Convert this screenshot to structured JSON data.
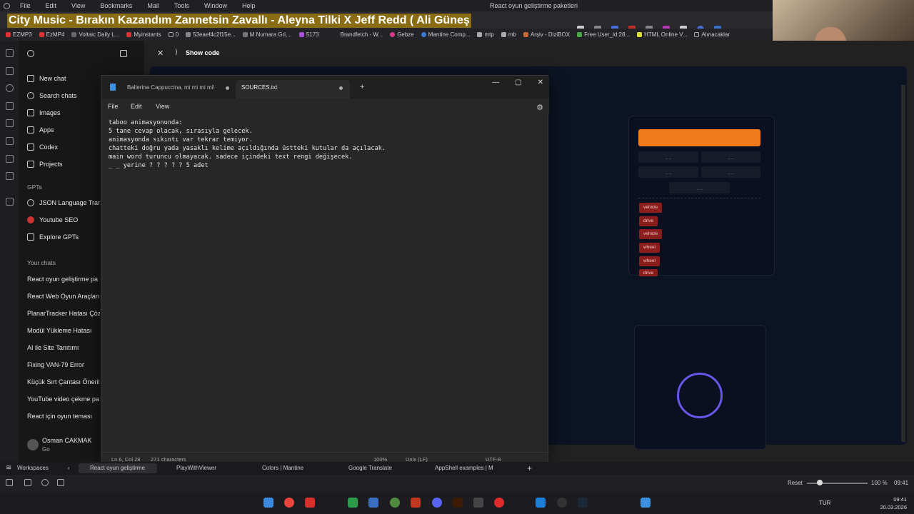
{
  "browser": {
    "menu": [
      "File",
      "Edit",
      "View",
      "Bookmarks",
      "Mail",
      "Tools",
      "Window",
      "Help"
    ],
    "window_title": "React oyun geliştirme paketleri",
    "banner": "City Music - Bırakın Kazandım Zannetsin Zavallı - Aleyna Tilki X Jeff Redd ( Ali Güneş",
    "bookmarks": [
      "EZMP3",
      "EzMP4",
      "Voltaic Daily L...",
      "Myinstants",
      "0",
      "53eaef4c2f15e...",
      "M Numara Gri,...",
      "5173",
      "Brandfetch - W...",
      "Gebze",
      "Mantine Comp...",
      "mtp",
      "mb",
      "Arşiv - DiziBOX",
      "Free User_ld:28...",
      "HTML Online V...",
      "Alınacaklar"
    ]
  },
  "sidebar": {
    "top_items": [
      "New chat",
      "Search chats",
      "Images",
      "Apps",
      "Codex",
      "Projects"
    ],
    "gpts_header": "GPTs",
    "gpts": [
      "JSON Language Tran",
      "Youtube SEO",
      "Explore GPTs"
    ],
    "chats_header": "Your chats",
    "chats": [
      "React oyun geliştirme pa",
      "React Web Oyun Araçları",
      "PlanarTracker Hatası Çözi",
      "Modül Yükleme Hatası",
      "AI ile Site Tanıtımı",
      "Fixing VAN-79 Error",
      "Küçük Sırt Çantası Öneril",
      "YouTube video çekme pa",
      "React için oyun teması"
    ],
    "user_name": "Osman CAKMAK",
    "user_plan": "Go"
  },
  "main": {
    "show_code": "Show code",
    "preview": {
      "slots": [
        "_ _",
        "_ _",
        "_ _",
        "_ _",
        "_ _"
      ],
      "tags": [
        "vehicle",
        "drive",
        "vehicle",
        "wheel",
        "wheel",
        "drive"
      ]
    }
  },
  "notepad": {
    "tabs": [
      "Ballerina Cappuccina, mi mi mi mi!",
      "SOURCES.txt"
    ],
    "menu": [
      "File",
      "Edit",
      "View"
    ],
    "lines": [
      "taboo animasyonunda:",
      "5 tane cevap olacak, sırasıyla gelecek.",
      "animasyonda sıkıntı var tekrar temiyor.",
      "chatteki doğru yada yasaklı kelime açıldığında üstteki kutular da açılacak.",
      "main word turuncu olmayacak. sadece içindeki text rengi değişecek.",
      "_ _ yerine ? ? ? ? ? 5 adet"
    ],
    "status": {
      "position": "Ln 6, Col 28",
      "chars": "271 characters",
      "zoom": "100%",
      "eol": "Unix (LF)",
      "encoding": "UTF-8"
    }
  },
  "workspace": {
    "label": "Workspaces",
    "tabs": [
      "React oyun geliştirme",
      "PlayWithViewer",
      "Colors | Mantine",
      "Google Translate",
      "AppShell examples | M"
    ]
  },
  "status_bar": {
    "reset": "Reset",
    "zoom": "100 %",
    "time": "09:41"
  },
  "taskbar": {
    "lang": "TUR",
    "time": "09:41",
    "date": "20.03.2026"
  }
}
